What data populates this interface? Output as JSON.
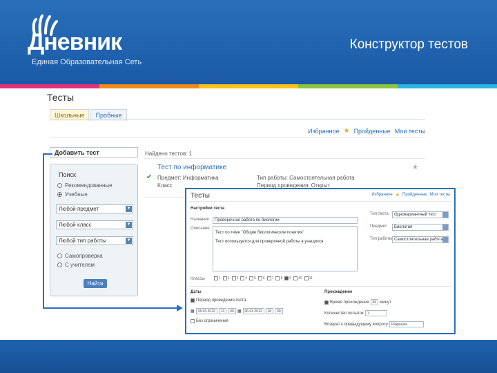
{
  "slide": {
    "logo_word": "Дневник",
    "logo_sub": "Единая Образовательная Сеть",
    "title": "Конструктор тестов",
    "stripe_colors": [
      "#e2337a",
      "#f18a1c",
      "#f8c21b",
      "#8cc63f",
      "#2ab4e0"
    ]
  },
  "app": {
    "page_title": "Тесты",
    "tabs": [
      {
        "label": "Школьные",
        "active": true
      },
      {
        "label": "Пробные",
        "active": false
      }
    ],
    "top_links": {
      "favorites": "Избранное",
      "passed": "Пройденные",
      "mine": "Мои тесты"
    },
    "add_test_label": "Добавить тест",
    "search": {
      "heading": "Поиск",
      "radio_1": "Рекомендованные",
      "radio_2": "Учебные",
      "select_subject": "Любой предмет",
      "select_class": "Любой класс",
      "select_work": "Любой тип работы",
      "radio_3": "Самопроверка",
      "radio_4": "С учителем",
      "find_button": "Найти"
    },
    "found_count": "Найдено тестов: 1",
    "result": {
      "title": "Тест по информатике",
      "line1": "Предмет: Информатика",
      "line2": "Класс",
      "right1": "Тип работы: Самостоятельная работа",
      "right2": "Период проведения: Открыт"
    }
  },
  "inset": {
    "title": "Тесты",
    "links": {
      "favorites": "Избранное",
      "passed": "Пройденные",
      "mine": "Мои тесты"
    },
    "section_settings": "Настройки теста",
    "label_name": "Название",
    "value_name": "Проверочная работа по биологии",
    "label_desc": "Описание",
    "desc_line1": "Тест по теме \"Общие биологические понятия\"",
    "desc_line2": "Тест используется для проверочной работы в учащихся",
    "label_type": "Тип теста",
    "value_type": "Одновариантный тест",
    "label_subject": "Предмет",
    "value_subject": "Биология",
    "label_work": "Тип работы",
    "value_work": "Самостоятельная работа",
    "label_classes": "Классы",
    "classes": [
      "1",
      "2",
      "3",
      "4",
      "5",
      "6",
      "7",
      "8",
      "9",
      "10",
      "11"
    ],
    "section_dates": "Даты",
    "period_label": "Период проведения теста",
    "date_from": "05.03.2012",
    "h_from": "13",
    "m_from": "00",
    "date_to": "06.03.2012",
    "h_to": "18",
    "m_to": "00",
    "unlimited_label": "Без ограничения",
    "section_passing": "Прохождение",
    "time_limit_label": "Время прохождения",
    "time_limit_value": "45",
    "minutes": "минут",
    "attempts_label": "Количество попыток",
    "attempts_value": "1",
    "return_label": "Возврат к предыдущему вопросу",
    "return_value": "Разрешен"
  }
}
